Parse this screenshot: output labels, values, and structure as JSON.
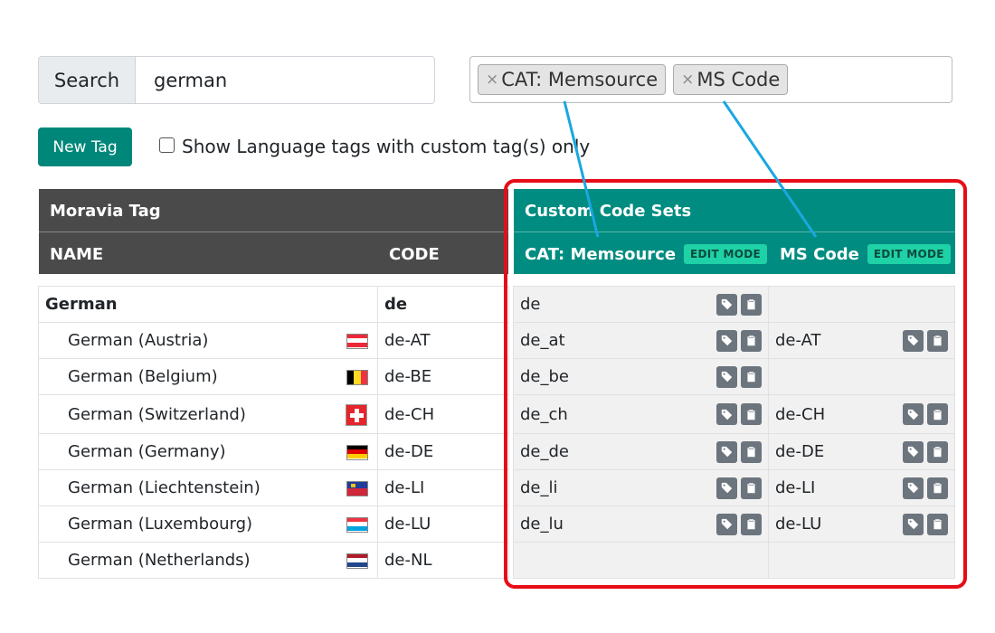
{
  "search": {
    "label": "Search",
    "value": "german"
  },
  "selected_tags": [
    {
      "remove": "×",
      "label": "CAT: Memsource"
    },
    {
      "remove": "×",
      "label": "MS Code"
    }
  ],
  "toolbar": {
    "new_tag_label": "New Tag",
    "filter_label": "Show Language tags with custom tag(s) only",
    "filter_checked": false
  },
  "table": {
    "group_left": "Moravia Tag",
    "group_right": "Custom Code Sets",
    "col_name": "NAME",
    "col_code": "CODE",
    "col_set1": "CAT: Memsource",
    "col_set2": "MS Code",
    "edit_mode": "EDIT MODE",
    "rows": [
      {
        "name": "German",
        "code": "de",
        "set1": "de",
        "set2": "",
        "flag": "none"
      },
      {
        "name": "German (Austria)",
        "code": "de-AT",
        "set1": "de_at",
        "set2": "de-AT",
        "flag": "austria"
      },
      {
        "name": "German (Belgium)",
        "code": "de-BE",
        "set1": "de_be",
        "set2": "",
        "flag": "belgium"
      },
      {
        "name": "German (Switzerland)",
        "code": "de-CH",
        "set1": "de_ch",
        "set2": "de-CH",
        "flag": "switzerland"
      },
      {
        "name": "German (Germany)",
        "code": "de-DE",
        "set1": "de_de",
        "set2": "de-DE",
        "flag": "germany"
      },
      {
        "name": "German (Liechtenstein)",
        "code": "de-LI",
        "set1": "de_li",
        "set2": "de-LI",
        "flag": "liechtenstein"
      },
      {
        "name": "German (Luxembourg)",
        "code": "de-LU",
        "set1": "de_lu",
        "set2": "de-LU",
        "flag": "luxembourg"
      },
      {
        "name": "German (Netherlands)",
        "code": "de-NL",
        "set1": "",
        "set2": "",
        "flag": "netherlands"
      }
    ]
  },
  "icons": {
    "tag": "tag-icon",
    "clipboard": "clipboard-icon"
  },
  "colors": {
    "accent": "#00877a",
    "header_dark": "#4a4a4a",
    "header_teal": "#008c80",
    "edit_badge": "#1fd1a6",
    "highlight_box": "#e60d18",
    "annotation_arrow": "#1aa7e0"
  }
}
